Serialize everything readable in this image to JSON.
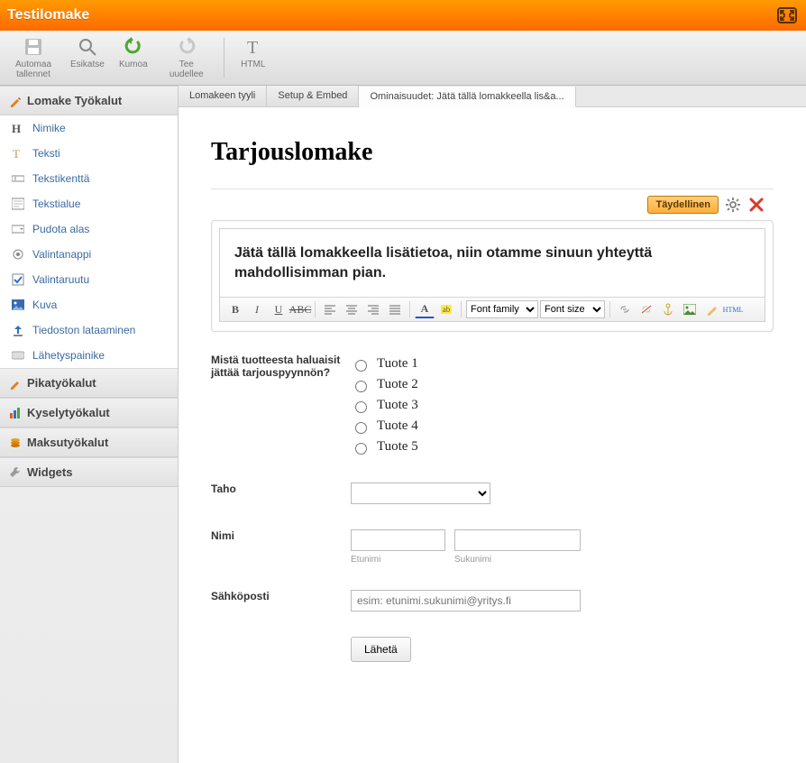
{
  "window_title": "Testilomake",
  "toolbar": [
    {
      "id": "autosave",
      "label": "Automaa tallennet"
    },
    {
      "id": "preview",
      "label": "Esikatse"
    },
    {
      "id": "undo",
      "label": "Kumoa"
    },
    {
      "id": "redo",
      "label": "Tee uudellee"
    },
    {
      "id": "html",
      "label": "HTML"
    }
  ],
  "sidebar": {
    "sections": {
      "form_tools": "Lomake Työkalut",
      "quick_tools": "Pikatyökalut",
      "survey_tools": "Kyselytyökalut",
      "pay_tools": "Maksutyökalut",
      "widgets": "Widgets"
    },
    "form_tools": [
      {
        "id": "heading",
        "label": "Nimike"
      },
      {
        "id": "text",
        "label": "Teksti"
      },
      {
        "id": "textbox",
        "label": "Tekstikenttä"
      },
      {
        "id": "textarea",
        "label": "Tekstialue"
      },
      {
        "id": "dropdown",
        "label": "Pudota alas"
      },
      {
        "id": "radio",
        "label": "Valintanappi"
      },
      {
        "id": "checkbox",
        "label": "Valintaruutu"
      },
      {
        "id": "image",
        "label": "Kuva"
      },
      {
        "id": "upload",
        "label": "Tiedoston lataaminen"
      },
      {
        "id": "submit",
        "label": "Lähetyspainike"
      }
    ]
  },
  "tabs": [
    {
      "id": "style",
      "label": "Lomakeen tyyli",
      "active": false
    },
    {
      "id": "embed",
      "label": "Setup & Embed",
      "active": false
    },
    {
      "id": "props",
      "label": "Ominaisuudet: Jätä tällä lomakkeella lis&a...",
      "active": true
    }
  ],
  "form": {
    "title": "Tarjouslomake",
    "selection_toolbar": {
      "complete_label": "Täydellinen"
    },
    "intro_text": "Jätä tällä lomakkeella lisätietoa, niin otamme sinuun yhteyttä mahdollisimman pian.",
    "editor": {
      "font_family_placeholder": "Font family",
      "font_size_placeholder": "Font size",
      "html_label": "HTML"
    },
    "product_question": "Mistä tuotteesta haluaisit jättää tarjouspyynnön?",
    "product_options": [
      "Tuote 1",
      "Tuote 2",
      "Tuote 3",
      "Tuote 4",
      "Tuote 5"
    ],
    "fields": {
      "party_label": "Taho",
      "name_label": "Nimi",
      "first_name_sub": "Etunimi",
      "last_name_sub": "Sukunimi",
      "email_label": "Sähköposti",
      "email_placeholder": "esim: etunimi.sukunimi@yritys.fi",
      "submit_label": "Lähetä"
    }
  }
}
